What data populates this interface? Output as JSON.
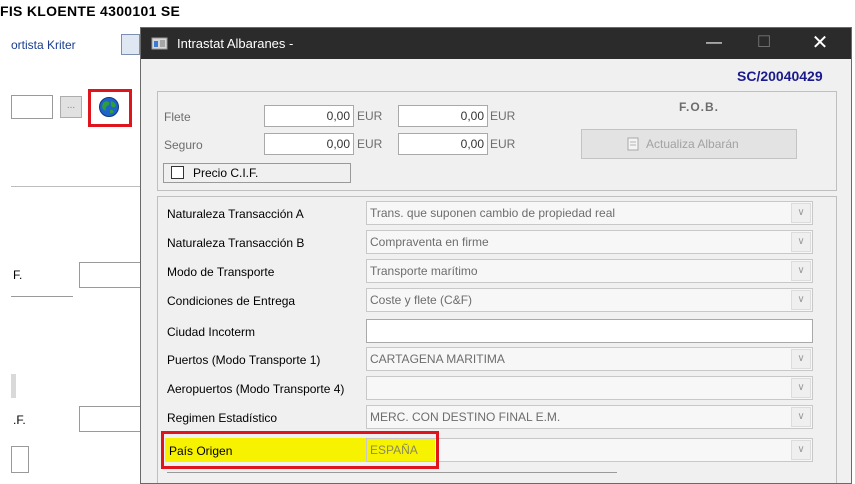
{
  "background": {
    "title": "FIS KLOENTE 4300101 SE",
    "link": "ortista Kriter",
    "button_dots": "...",
    "globe_icon": "globe-icon",
    "label_f1": "F.",
    "label_f2": ".F."
  },
  "dialog": {
    "title": "Intrastat Albaranes -",
    "code": "SC/20040429",
    "colors": {
      "code": "#1a1a8c",
      "titlebar": "#2b2b2b",
      "highlight": "#f7f300",
      "red": "#e0141c"
    },
    "fob_label": "F.O.B.",
    "flete_label": "Flete",
    "seguro_label": "Seguro",
    "flete_value1": "0,00",
    "flete_value2": "0,00",
    "seguro_value1": "0,00",
    "seguro_value2": "0,00",
    "currency": "EUR",
    "actualiza_button": "Actualiza Albarán",
    "precio_cif_label": "Precio C.I.F.",
    "precio_cif_checked": false,
    "fields": [
      {
        "label": "Naturaleza Transacción A",
        "value": "Trans. que suponen cambio de propiedad real"
      },
      {
        "label": "Naturaleza Transacción B",
        "value": "Compraventa en firme"
      },
      {
        "label": "Modo de Transporte",
        "value": "Transporte marítimo"
      },
      {
        "label": "Condiciones de Entrega",
        "value": "Coste y flete (C&F)"
      },
      {
        "label": "Ciudad Incoterm",
        "value": ""
      },
      {
        "label": "Puertos (Modo Transporte 1)",
        "value": "CARTAGENA MARITIMA"
      },
      {
        "label": "Aeropuertos (Modo Transporte 4)",
        "value": ""
      },
      {
        "label": "Regimen Estadístico",
        "value": "MERC. CON DESTINO FINAL E.M."
      },
      {
        "label": "País Origen",
        "value": "ESPAÑA"
      }
    ]
  }
}
